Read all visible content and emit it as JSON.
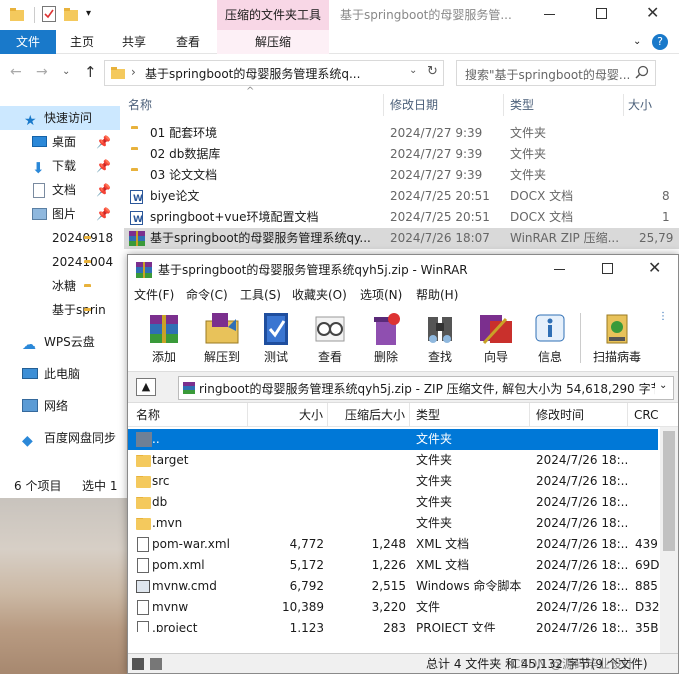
{
  "explorer": {
    "title": "基于springboot的母婴服务管...",
    "context_tab": "压缩的文件夹工具",
    "tabs": [
      "文件",
      "主页",
      "共享",
      "查看",
      "解压缩"
    ],
    "address": "基于springboot的母婴服务管理系统q...",
    "search_placeholder": "搜索\"基于springboot的母婴...",
    "columns": {
      "name": "名称",
      "date": "修改日期",
      "type": "类型",
      "size": "大小"
    },
    "files": [
      {
        "name": "01 配套环境",
        "date": "2024/7/27 9:39",
        "type": "文件夹",
        "size": "",
        "icon": "folder-icon"
      },
      {
        "name": "02 db数据库",
        "date": "2024/7/27 9:39",
        "type": "文件夹",
        "size": "",
        "icon": "folder-icon"
      },
      {
        "name": "03 论文文档",
        "date": "2024/7/27 9:39",
        "type": "文件夹",
        "size": "",
        "icon": "folder-icon"
      },
      {
        "name": "biye论文",
        "date": "2024/7/25 20:51",
        "type": "DOCX 文档",
        "size": "8",
        "icon": "word-doc-icon"
      },
      {
        "name": "springboot+vue环境配置文档",
        "date": "2024/7/25 20:51",
        "type": "DOCX 文档",
        "size": "1",
        "icon": "word-doc-icon"
      },
      {
        "name": "基于springboot的母婴服务管理系统qy...",
        "date": "2024/7/26 18:07",
        "type": "WinRAR ZIP 压缩...",
        "size": "25,79",
        "icon": "winrar-zip-icon"
      }
    ],
    "nav": [
      {
        "label": "快速访问",
        "icon": "star-icon"
      },
      {
        "label": "桌面",
        "icon": "desktop-icon"
      },
      {
        "label": "下载",
        "icon": "download-icon"
      },
      {
        "label": "文档",
        "icon": "document-icon"
      },
      {
        "label": "图片",
        "icon": "picture-icon"
      },
      {
        "label": "20240918",
        "icon": "folder-icon"
      },
      {
        "label": "20241004",
        "icon": "folder-icon"
      },
      {
        "label": "冰糖",
        "icon": "folder-icon"
      },
      {
        "label": "基于sprin",
        "icon": "folder-icon"
      },
      {
        "label": "WPS云盘",
        "icon": "cloud-icon"
      },
      {
        "label": "此电脑",
        "icon": "computer-icon"
      },
      {
        "label": "网络",
        "icon": "network-icon"
      },
      {
        "label": "百度网盘同步",
        "icon": "baidu-cloud-icon"
      }
    ],
    "status_count": "6 个项目",
    "status_selected": "选中 1"
  },
  "winrar": {
    "title": "基于springboot的母婴服务管理系统qyh5j.zip - WinRAR",
    "menu": [
      "文件(F)",
      "命令(C)",
      "工具(S)",
      "收藏夹(O)",
      "选项(N)",
      "帮助(H)"
    ],
    "toolbar": [
      "添加",
      "解压到",
      "测试",
      "查看",
      "删除",
      "查找",
      "向导",
      "信息",
      "扫描病毒"
    ],
    "path": "ringboot的母婴服务管理系统qyh5j.zip - ZIP 压缩文件, 解包大小为 54,618,290 字节",
    "columns": {
      "name": "名称",
      "size": "大小",
      "packed": "压缩后大小",
      "type": "类型",
      "modified": "修改时间",
      "crc": "CRC"
    },
    "rows": [
      {
        "name": "..",
        "size": "",
        "packed": "",
        "type": "文件夹",
        "modified": "",
        "crc": "",
        "icon": "parent-folder-icon"
      },
      {
        "name": "target",
        "size": "",
        "packed": "",
        "type": "文件夹",
        "modified": "2024/7/26 18:...",
        "crc": "",
        "icon": "folder-icon"
      },
      {
        "name": "src",
        "size": "",
        "packed": "",
        "type": "文件夹",
        "modified": "2024/7/26 18:...",
        "crc": "",
        "icon": "folder-icon"
      },
      {
        "name": "db",
        "size": "",
        "packed": "",
        "type": "文件夹",
        "modified": "2024/7/26 18:...",
        "crc": "",
        "icon": "folder-icon"
      },
      {
        "name": ".mvn",
        "size": "",
        "packed": "",
        "type": "文件夹",
        "modified": "2024/7/26 18:...",
        "crc": "",
        "icon": "folder-icon"
      },
      {
        "name": "pom-war.xml",
        "size": "4,772",
        "packed": "1,248",
        "type": "XML 文档",
        "modified": "2024/7/26 18:...",
        "crc": "439",
        "icon": "xml-file-icon"
      },
      {
        "name": "pom.xml",
        "size": "5,172",
        "packed": "1,226",
        "type": "XML 文档",
        "modified": "2024/7/26 18:...",
        "crc": "69D",
        "icon": "xml-file-icon"
      },
      {
        "name": "mvnw.cmd",
        "size": "6,792",
        "packed": "2,515",
        "type": "Windows 命令脚本",
        "modified": "2024/7/26 18:...",
        "crc": "885",
        "icon": "cmd-file-icon"
      },
      {
        "name": "mvnw",
        "size": "10,389",
        "packed": "3,220",
        "type": "文件",
        "modified": "2024/7/26 18:...",
        "crc": "D32",
        "icon": "file-icon"
      },
      {
        "name": ".project",
        "size": "1,123",
        "packed": "283",
        "type": "PROJECT 文件",
        "modified": "2024/7/26 18:...",
        "crc": "35B",
        "icon": "file-icon"
      }
    ],
    "status": "总计 4 文件夹 和 45,132 字节(9 个文件)",
    "watermark": "CSDN @源码毕业设计"
  },
  "colors": {
    "accent": "#1979ca",
    "context_tab": "#f8d7e6",
    "selected_row": "#0078d7",
    "hover_row": "#cce8ff"
  }
}
